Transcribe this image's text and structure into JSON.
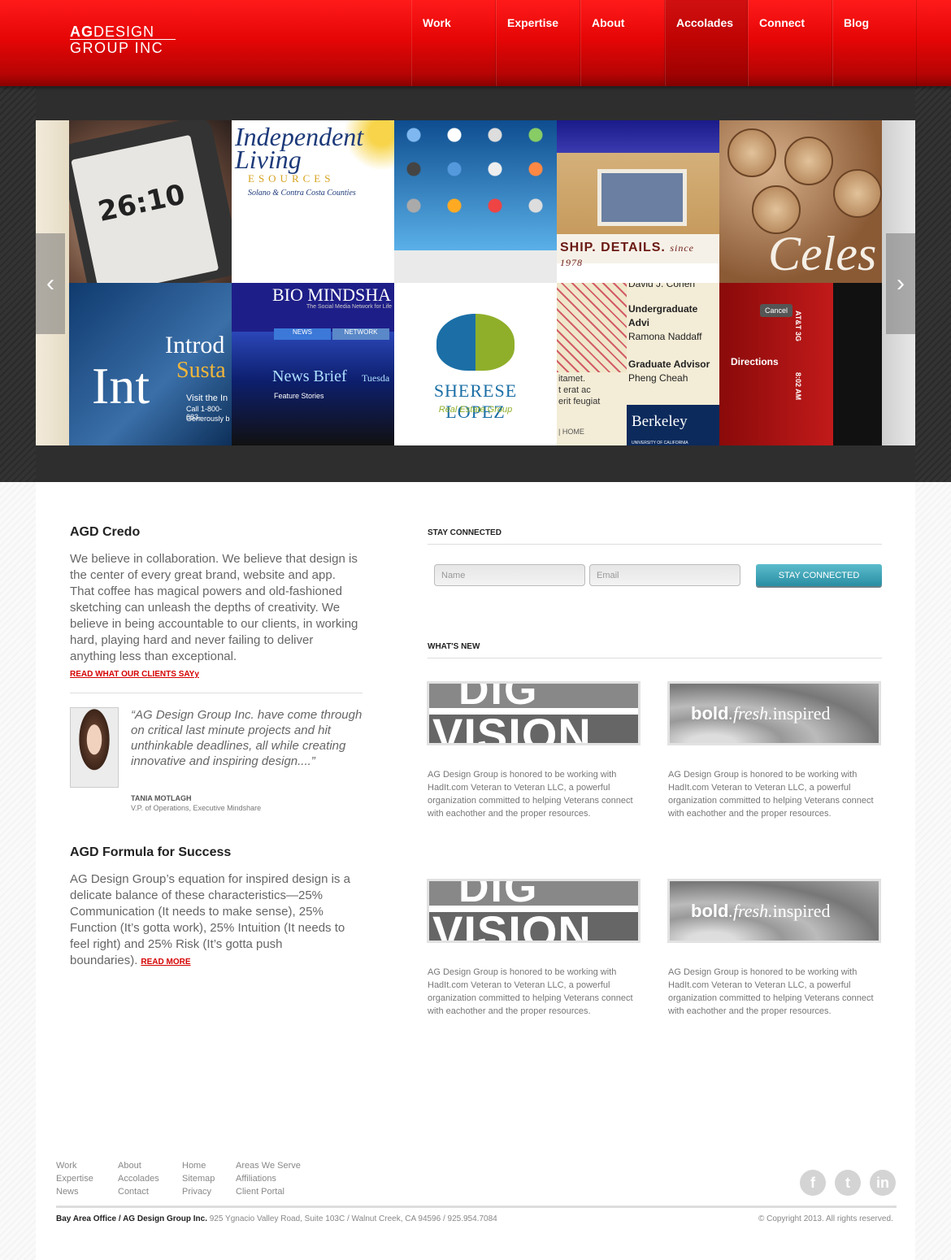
{
  "logo": {
    "line1_bold": "AG",
    "line1_rest": "DESIGN",
    "line2": "GROUP INC"
  },
  "nav": [
    {
      "label": "Work",
      "active": false
    },
    {
      "label": "Expertise",
      "active": false
    },
    {
      "label": "About",
      "active": false
    },
    {
      "label": "Accolades",
      "active": true
    },
    {
      "label": "Connect",
      "active": false
    },
    {
      "label": "Blog",
      "active": false
    }
  ],
  "slider": {
    "prev_icon": "chevron-left-icon",
    "next_icon": "chevron-right-icon",
    "prev_glyph": "‹",
    "next_glyph": "›",
    "tiles": [
      {
        "name": "tile-meeting-manager",
        "text": "26:10"
      },
      {
        "name": "tile-independent-living",
        "text": "Independent Living",
        "sub": "ESOURCES",
        "sub2": "Solano & Contra Costa Counties"
      },
      {
        "name": "tile-ipod-icons",
        "text": ""
      },
      {
        "name": "tile-house-details",
        "text": "SHIP. DETAILS.",
        "since": "since 1978"
      },
      {
        "name": "tile-wine-corks",
        "text": "Celes"
      },
      {
        "name": "tile-intro-sustain",
        "text": "Int",
        "intro": "Introd",
        "susta": "Susta",
        "visit": "Visit the In",
        "call": "Call 1-800-683-",
        "gen": "Generously b"
      },
      {
        "name": "tile-bio-mindshare",
        "text": "BIO MINDSHA",
        "tagline": "The Social Media Network for Life",
        "tab1": "NEWS",
        "tab2": "NETWORK",
        "news": "News Brief",
        "day": "Tuesda",
        "feature": "Feature Stories"
      },
      {
        "name": "tile-sherese-lopez",
        "text": "SHERESE LOPEZ",
        "sub": "Real Estate Group"
      },
      {
        "name": "tile-berkeley",
        "person": "David J. Cohen",
        "ug_label": "Undergraduate Advi",
        "ug_name": "Ramona Naddaff",
        "grad_label": "Graduate Advisor",
        "grad_name": "Pheng Cheah",
        "text": "Berkeley",
        "uni": "UNIVERSITY OF CALIFORNIA",
        "home": "|  HOME",
        "lorem1": "itamet.",
        "lorem2": "t erat ac",
        "lorem3": "erit feugiat"
      },
      {
        "name": "tile-directions-app",
        "text": "Directions",
        "cancel": "Cancel",
        "carrier": "AT&T 3G",
        "time": "8:02 AM"
      }
    ]
  },
  "credo": {
    "title": "AGD Credo",
    "body": "We believe in collaboration. We believe that design is the center of every great brand, website and app. That coffee has magical powers and old-fashioned sketching can unleash the depths of creativity. We believe in being accountable to our clients, in working hard, playing hard and never failing to deliver anything less than exceptional.",
    "link": "READ WHAT OUR CLIENTS SAYy"
  },
  "testimonial": {
    "quote": "“AG Design Group Inc. have come through on critical last minute projects and hit unthinkable deadlines, all while creating innovative and inspiring design....”",
    "name": "TANIA MOTLAGH",
    "role": "V.P. of Operations, Executive Mindshare"
  },
  "formula": {
    "title": "AGD Formula for Success",
    "body": "AG Design Group’s equation for inspired design is a delicate balance of these characteristics—25% Communication (It needs to make sense), 25% Function (It’s gotta work), 25% Intuition (It needs to feel right) and 25% Risk (It’s gotta push boundaries).",
    "link": "READ MORE"
  },
  "stay_connected": {
    "label": "STAY CONNECTED",
    "name_placeholder": "Name",
    "email_placeholder": "Email",
    "button": "STAY CONNECTED"
  },
  "whats_new": {
    "label": "WHAT'S NEW",
    "items": [
      {
        "image": "DIGI VISION",
        "image_top": "DIG",
        "image_word": "VISION",
        "text": "AG Design Group is honored to be working with HadIt.com Veteran to Veteran LLC, a powerful organization committed to helping Veterans connect with eachother and the proper resources."
      },
      {
        "image": "bold.fresh.inspired",
        "w1": "bold",
        "w2": ".fresh.",
        "w3": "inspired",
        "text": "AG Design Group is honored to be working with HadIt.com Veteran to Veteran LLC, a powerful organization committed to helping Veterans connect with eachother and the proper resources."
      },
      {
        "image": "DIGI VISION",
        "image_top": "DIG",
        "image_word": "VISION",
        "text": "AG Design Group is honored to be working with HadIt.com Veteran to Veteran LLC, a powerful organization committed to helping Veterans connect with eachother and the proper resources."
      },
      {
        "image": "bold.fresh.inspired",
        "w1": "bold",
        "w2": ".fresh.",
        "w3": "inspired",
        "text": "AG Design Group is honored to be working with HadIt.com Veteran to Veteran LLC, a powerful organization committed to helping Veterans connect with eachother and the proper resources."
      }
    ]
  },
  "footer": {
    "col1": [
      "Work",
      "Expertise",
      "News"
    ],
    "col2": [
      "About",
      "Accolades",
      "Contact"
    ],
    "col3": [
      "Home",
      "Sitemap",
      "Privacy"
    ],
    "col4": [
      "Areas We Serve",
      "Affiliations",
      "Client Portal"
    ],
    "social": [
      {
        "name": "facebook-icon",
        "glyph": "f"
      },
      {
        "name": "twitter-icon",
        "glyph": "t"
      },
      {
        "name": "linkedin-icon",
        "glyph": "in"
      }
    ],
    "office_label": "Bay Area Office / AG Design Group Inc.",
    "address": "925 Ygnacio Valley Road, Suite 103C / Walnut Creek, CA 94596 / 925.954.7084",
    "copyright": "© Copyright 2013. All rights reserved."
  },
  "colors": {
    "brand_red": "#e60606",
    "button_teal": "#2a8ea3",
    "link_red": "#d50000"
  }
}
